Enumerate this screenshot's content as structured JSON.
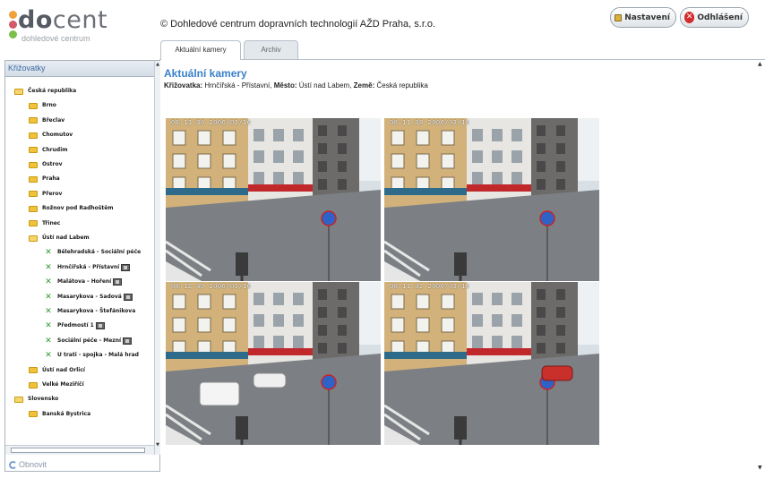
{
  "header": {
    "logo_do": "do",
    "logo_cent": "cent",
    "logo_sub": "dohledové centrum",
    "company": "© Dohledové centrum dopravních technologií AŽD Praha, s.r.o.",
    "buttons": {
      "settings_label": "Nastavení",
      "logout_label": "Odhlášení"
    },
    "colors": {
      "logo_dot_1": "#f0a23a",
      "logo_dot_2": "#d35a6a",
      "logo_dot_3": "#7cbf4a"
    }
  },
  "tabs": [
    {
      "label": "Aktuální kamery",
      "active": true
    },
    {
      "label": "Archiv",
      "active": false
    }
  ],
  "sidebar": {
    "title": "Křižovatky",
    "refresh_label": "Obnovit",
    "tree": [
      {
        "label": "Česká republika",
        "level": 0,
        "type": "folder-open"
      },
      {
        "label": "Brno",
        "level": 1,
        "type": "folder"
      },
      {
        "label": "Břeclav",
        "level": 1,
        "type": "folder"
      },
      {
        "label": "Chomutov",
        "level": 1,
        "type": "folder"
      },
      {
        "label": "Chrudim",
        "level": 1,
        "type": "folder"
      },
      {
        "label": "Ostrov",
        "level": 1,
        "type": "folder"
      },
      {
        "label": "Praha",
        "level": 1,
        "type": "folder"
      },
      {
        "label": "Přerov",
        "level": 1,
        "type": "folder"
      },
      {
        "label": "Rožnov pod Radhoštěm",
        "level": 1,
        "type": "folder"
      },
      {
        "label": "Třinec",
        "level": 1,
        "type": "folder"
      },
      {
        "label": "Ústí nad Labem",
        "level": 1,
        "type": "folder-open"
      },
      {
        "label": "Bělehradská - Sociální péče",
        "level": 2,
        "type": "camera",
        "badge": false
      },
      {
        "label": "Hrnčířská - Přístavní",
        "level": 2,
        "type": "camera",
        "badge": true
      },
      {
        "label": "Malátova - Hoření",
        "level": 2,
        "type": "camera",
        "badge": true
      },
      {
        "label": "Masarykova - Sadová",
        "level": 2,
        "type": "camera",
        "badge": true
      },
      {
        "label": "Masarykova - Štefánikova",
        "level": 2,
        "type": "camera",
        "badge": false
      },
      {
        "label": "Předmostí 1",
        "level": 2,
        "type": "camera",
        "badge": true
      },
      {
        "label": "Sociální péče - Mezní",
        "level": 2,
        "type": "camera",
        "badge": true
      },
      {
        "label": "U trati - spojka - Malá hrad",
        "level": 2,
        "type": "camera",
        "badge": false
      },
      {
        "label": "Ústí nad Orlicí",
        "level": 1,
        "type": "folder"
      },
      {
        "label": "Velké Meziříčí",
        "level": 1,
        "type": "folder"
      },
      {
        "label": "Slovensko",
        "level": 0,
        "type": "folder-open"
      },
      {
        "label": "Banská Bystrica",
        "level": 1,
        "type": "folder"
      }
    ]
  },
  "main": {
    "title": "Aktuální kamery",
    "info": {
      "crossing_label": "Křižovatka:",
      "crossing_value": "Hrnčířská - Přístavní,",
      "city_label": "Město:",
      "city_value": "Ústí nad Labem,",
      "country_label": "Země:",
      "country_value": "Česká republika"
    },
    "cameras": [
      {
        "stamp": "08:11:30 2006/03/10",
        "cars": []
      },
      {
        "stamp": "08:11:38 2006/03/10",
        "cars": []
      },
      {
        "stamp": "08:12:49 2006/03/10",
        "cars": [
          "white-van",
          "white-car"
        ]
      },
      {
        "stamp": "08:11:32 2006/03/10",
        "cars": [
          "red-car"
        ]
      }
    ]
  }
}
